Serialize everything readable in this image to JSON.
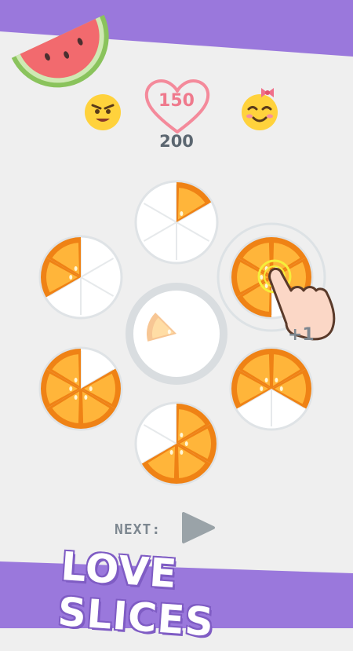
{
  "score": {
    "current": "150",
    "target": "200"
  },
  "next_label": "NEXT:",
  "title": "LOVE SLICES",
  "bonus_text": "+1",
  "colors": {
    "purple": "#9a78dc",
    "orange": "#f7941e",
    "orange_dark": "#ef8215",
    "pulp": "#ffb53a",
    "heart": "#f48a9b",
    "plate": "#dfe3e6"
  },
  "plates": [
    {
      "id": "top",
      "filled": 1
    },
    {
      "id": "upper-left",
      "filled": 2
    },
    {
      "id": "upper-right",
      "filled": 5
    },
    {
      "id": "center",
      "filled": 1
    },
    {
      "id": "lower-left",
      "filled": 5
    },
    {
      "id": "lower-right",
      "filled": 4
    },
    {
      "id": "bottom",
      "filled": 4
    }
  ]
}
